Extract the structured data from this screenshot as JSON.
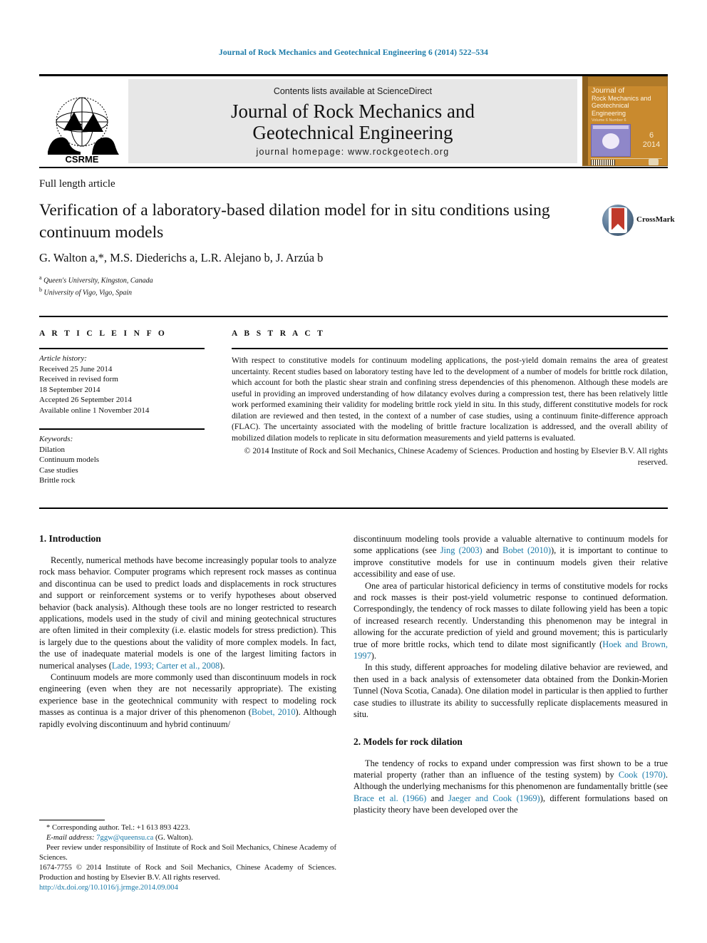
{
  "running_head": "Journal of Rock Mechanics and Geotechnical Engineering 6 (2014) 522–534",
  "masthead": {
    "contents_line": "Contents lists available at ScienceDirect",
    "journal_title_line1": "Journal of Rock Mechanics and",
    "journal_title_line2": "Geotechnical Engineering",
    "homepage_line": "journal homepage: www.rockgeotech.org",
    "society_logo_text": "CSRME",
    "cover": {
      "line1": "Journal of",
      "line2": "Rock Mechanics and",
      "line3": "Geotechnical",
      "line4": "Engineering",
      "line5": "Volume 6  Number 6",
      "volume": "6",
      "year": "2014"
    }
  },
  "article": {
    "type": "Full length article",
    "title_line1": "Verification of a laboratory-based dilation model for in situ conditions",
    "title_line2": "using continuum models",
    "crossmark_label": "CrossMark",
    "authors": "G. Walton a,*, M.S. Diederichs a, L.R. Alejano b, J. Arzúa b",
    "affiliation_a": "Queen's University, Kingston, Canada",
    "affiliation_b": "University of Vigo, Vigo, Spain"
  },
  "info": {
    "heading": "A R T I C L E  I N F O",
    "history_label": "Article history:",
    "history": [
      "Received 25 June 2014",
      "Received in revised form",
      "18 September 2014",
      "Accepted 26 September 2014",
      "Available online 1 November 2014"
    ],
    "keywords_label": "Keywords:",
    "keywords": [
      "Dilation",
      "Continuum models",
      "Case studies",
      "Brittle rock"
    ]
  },
  "abstract": {
    "heading": "A B S T R A C T",
    "text": "With respect to constitutive models for continuum modeling applications, the post-yield domain remains the area of greatest uncertainty. Recent studies based on laboratory testing have led to the development of a number of models for brittle rock dilation, which account for both the plastic shear strain and confining stress dependencies of this phenomenon. Although these models are useful in providing an improved understanding of how dilatancy evolves during a compression test, there has been relatively little work performed examining their validity for modeling brittle rock yield in situ. In this study, different constitutive models for rock dilation are reviewed and then tested, in the context of a number of case studies, using a continuum finite-difference approach (FLAC). The uncertainty associated with the modeling of brittle fracture localization is addressed, and the overall ability of mobilized dilation models to replicate in situ deformation measurements and yield patterns is evaluated.",
    "copyright": "© 2014 Institute of Rock and Soil Mechanics, Chinese Academy of Sciences. Production and hosting by Elsevier B.V. All rights reserved."
  },
  "body": {
    "section1_heading": "1. Introduction",
    "section2_heading": "2. Models for rock dilation",
    "left_p1_a": "Recently, numerical methods have become increasingly popular tools to analyze rock mass behavior. Computer programs which represent rock masses as continua and discontinua can be used to predict loads and displacements in rock structures and support or reinforcement systems or to verify hypotheses about observed behavior (back analysis). Although these tools are no longer restricted to research applications, models used in the study of civil and mining geotechnical structures are often limited in their complexity (i.e. elastic models for stress prediction). This is largely due to the questions about the validity of more complex models. In fact, the use of inadequate material models is one of the largest limiting factors in numerical analyses (",
    "left_p1_ref": "Lade, 1993; Carter et al., 2008",
    "left_p1_b": ").",
    "left_p2_a": "Continuum models are more commonly used than discontinuum models in rock engineering (even when they are not necessarily appropriate). The existing experience base in the geotechnical community with respect to modeling rock masses as continua is a major driver of this phenomenon (",
    "left_p2_ref": "Bobet, 2010",
    "left_p2_b": "). Although rapidly evolving discontinuum and hybrid continuum/",
    "right_p1_a": "discontinuum modeling tools provide a valuable alternative to continuum models for some applications (see ",
    "right_p1_ref1": "Jing (2003)",
    "right_p1_mid": " and ",
    "right_p1_ref2": "Bobet (2010)",
    "right_p1_b": "), it is important to continue to improve constitutive models for use in continuum models given their relative accessibility and ease of use.",
    "right_p2_a": "One area of particular historical deficiency in terms of constitutive models for rocks and rock masses is their post-yield volumetric response to continued deformation. Correspondingly, the tendency of rock masses to dilate following yield has been a topic of increased research recently. Understanding this phenomenon may be integral in allowing for the accurate prediction of yield and ground movement; this is particularly true of more brittle rocks, which tend to dilate most significantly (",
    "right_p2_ref": "Hoek and Brown, 1997",
    "right_p2_b": ").",
    "right_p3": "In this study, different approaches for modeling dilative behavior are reviewed, and then used in a back analysis of extensometer data obtained from the Donkin-Morien Tunnel (Nova Scotia, Canada). One dilation model in particular is then applied to further case studies to illustrate its ability to successfully replicate displacements measured in situ.",
    "right_p4_a": "The tendency of rocks to expand under compression was first shown to be a true material property (rather than an influence of the testing system) by ",
    "right_p4_ref1": "Cook (1970)",
    "right_p4_mid1": ". Although the underlying mechanisms for this phenomenon are fundamentally brittle (see ",
    "right_p4_ref2": "Brace et al. (1966)",
    "right_p4_mid2": " and ",
    "right_p4_ref3": "Jaeger and Cook (1969)",
    "right_p4_b": "), different formulations based on plasticity theory have been developed over the"
  },
  "footnote": {
    "corresponding": "* Corresponding author. Tel.: +1 613 893 4223.",
    "email_label": "E-mail address:",
    "email": "7ggw@queensu.ca",
    "email_suffix": "(G. Walton).",
    "peer_review": "Peer review under responsibility of Institute of Rock and Soil Mechanics, Chinese Academy of Sciences.",
    "issn_line": "1674-7755 © 2014 Institute of Rock and Soil Mechanics, Chinese Academy of Sciences. Production and hosting by Elsevier B.V. All rights reserved.",
    "doi": "http://dx.doi.org/10.1016/j.jrmge.2014.09.004"
  },
  "colors": {
    "link": "#1a7aa8",
    "masthead_bg": "#e7e7e7",
    "cover_bg": "#c98a2e"
  }
}
